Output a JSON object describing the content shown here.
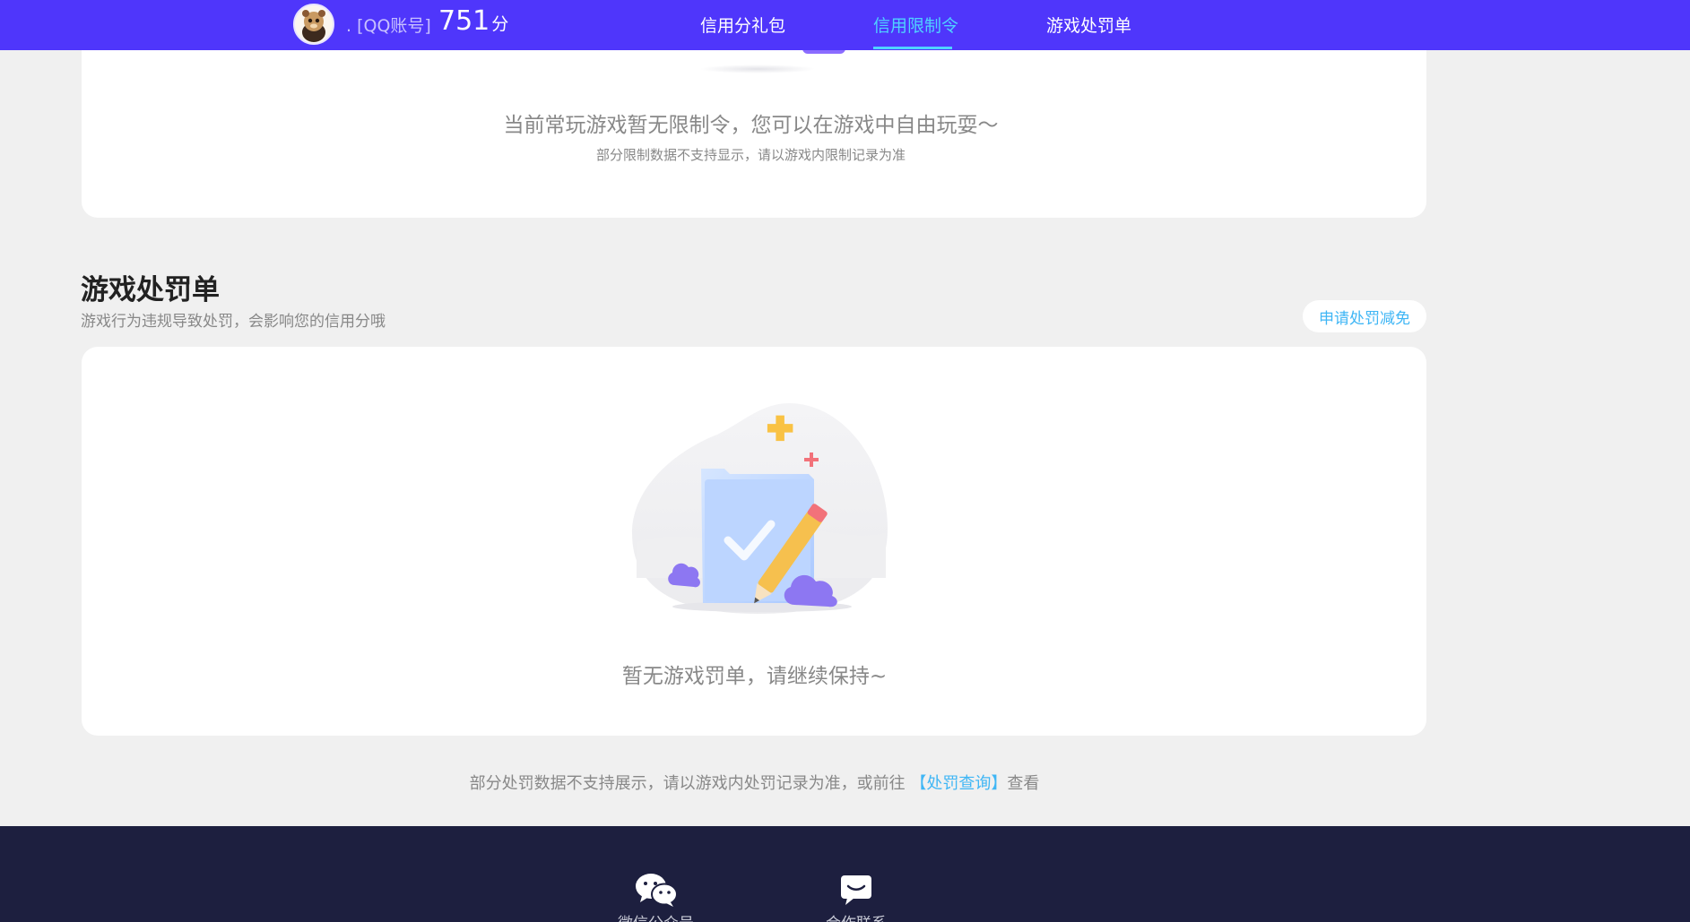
{
  "header": {
    "user_name": ". [QQ账号]",
    "score": "751",
    "score_unit": "分",
    "nav": [
      {
        "label": "信用分礼包",
        "active": false
      },
      {
        "label": "信用限制令",
        "active": true
      },
      {
        "label": "游戏处罚单",
        "active": false
      }
    ]
  },
  "restriction": {
    "message": "当前常玩游戏暂无限制令，您可以在游戏中自由玩耍～",
    "sub": "部分限制数据不支持显示，请以游戏内限制记录为准"
  },
  "penalty": {
    "title": "游戏处罚单",
    "subtitle": "游戏行为违规导致处罚，会影响您的信用分哦",
    "appeal_button": "申请处罚减免",
    "empty_message": "暂无游戏罚单，请继续保持~",
    "footer_note_prefix": "部分处罚数据不支持展示，请以游戏内处罚记录为准，或前往 ",
    "footer_note_link": "【处罚查询】",
    "footer_note_suffix": "查看"
  },
  "footer": {
    "items": [
      {
        "label": "微信公众号",
        "icon": "wechat-icon"
      },
      {
        "label": "合作联系",
        "icon": "chat-icon"
      }
    ]
  },
  "colors": {
    "topbar": "#4f36fb",
    "nav_active": "#4fd2ff",
    "link": "#3fb6f5",
    "footer": "#1d1f3f"
  }
}
